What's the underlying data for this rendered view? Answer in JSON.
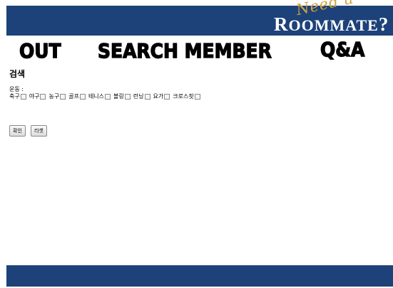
{
  "header": {
    "logo_need": "Need a",
    "logo_main_prefix": "R",
    "logo_main_small": "OOMMATE",
    "logo_main_suffix": "?"
  },
  "nav": {
    "out": "OUT",
    "search_member": "SEARCH MEMBER",
    "qa": "Q&A"
  },
  "search": {
    "title": "검색",
    "section_label": "운동 :",
    "options": [
      "축구",
      "야구",
      "농구",
      "골프",
      "테니스",
      "볼링",
      "런닝",
      "요가",
      "크로스핏"
    ]
  },
  "buttons": {
    "confirm": "확인",
    "reset": "리셋"
  },
  "colors": {
    "bar": "#1d4279",
    "accent": "#d1a43c"
  }
}
